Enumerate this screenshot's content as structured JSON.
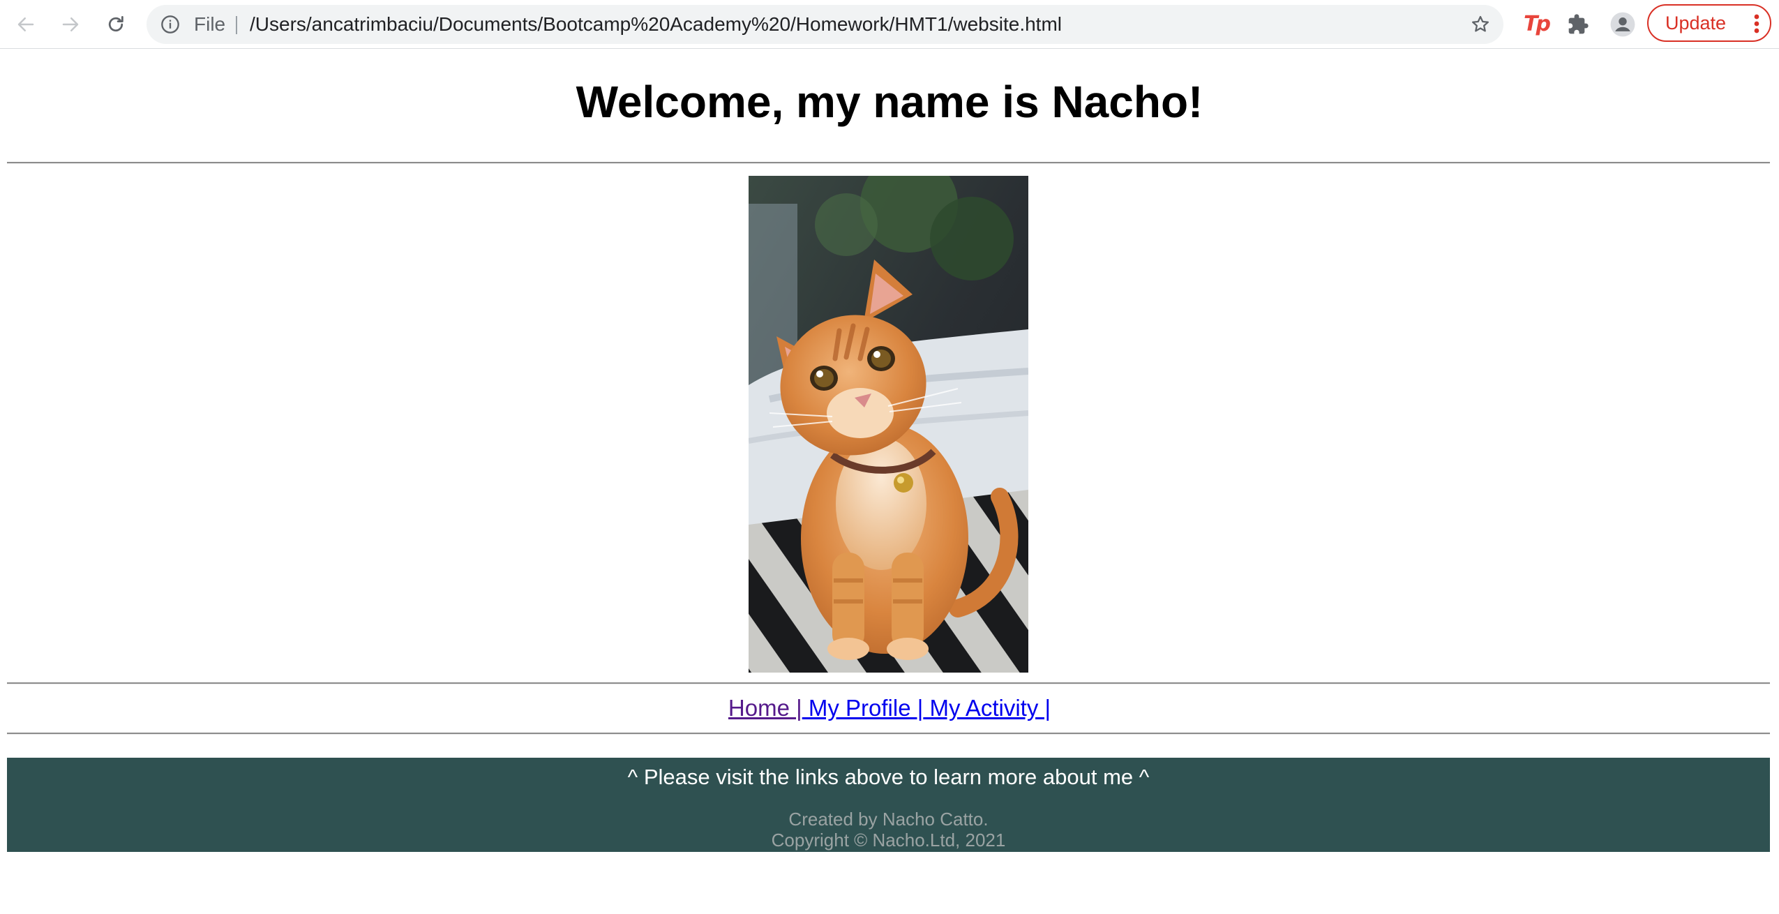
{
  "browser": {
    "scheme_label": "File",
    "url": "/Users/ancatrimbaciu/Documents/Bootcamp%20Academy%20/Homework/HMT1/website.html",
    "update_label": "Update",
    "extension_label": "Tp",
    "icons": {
      "back": "back-arrow-icon",
      "forward": "forward-arrow-icon",
      "reload": "reload-icon",
      "info": "info-icon",
      "bookmark": "star-icon",
      "extensions": "puzzle-icon",
      "profile": "avatar-icon",
      "menu": "kebab-menu-icon"
    },
    "accent_color": "#d93025"
  },
  "page": {
    "title": "Welcome, my name is Nacho!",
    "image_alt": "Orange tabby cat",
    "nav": {
      "home": "Home |",
      "profile": " My Profile |",
      "activity": " My Activity |"
    },
    "footer": {
      "note": "^ Please visit the links above to learn more about me ^",
      "created": "Created by Nacho Catto.",
      "copyright": "Copyright © Nacho.Ltd, 2021",
      "background_color": "#2f5151"
    }
  }
}
